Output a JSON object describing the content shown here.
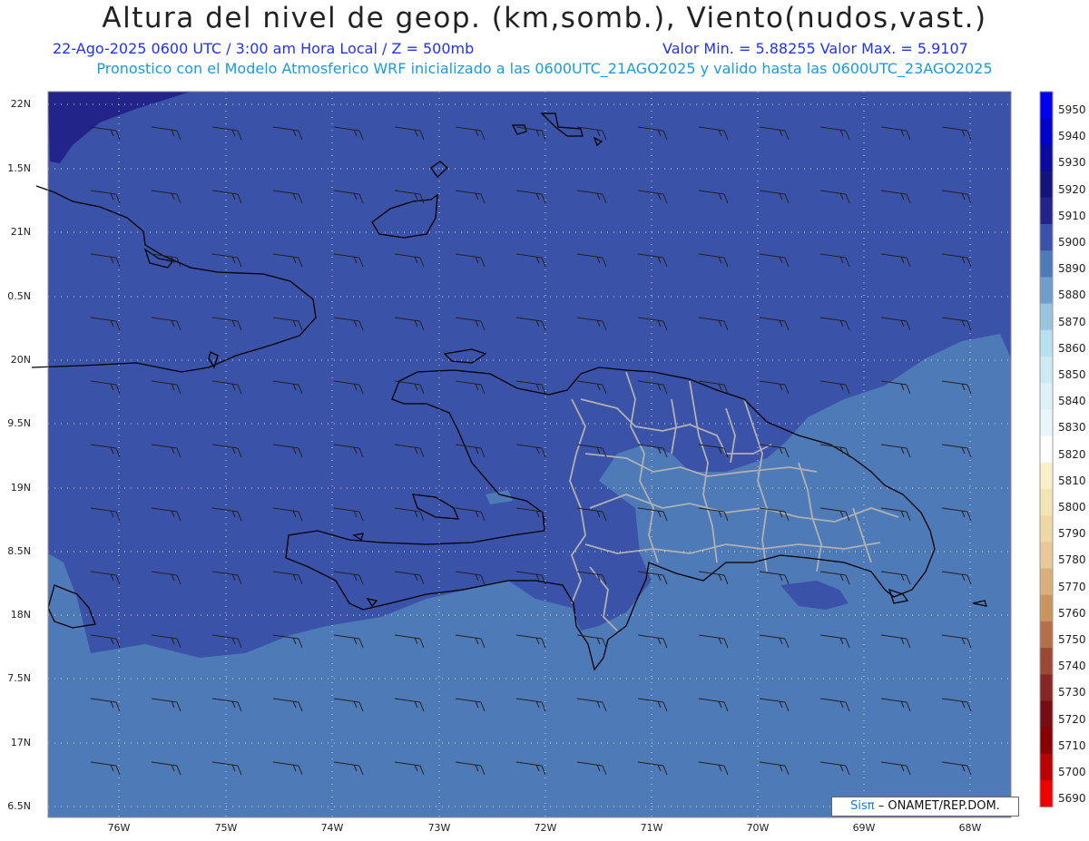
{
  "header": {
    "title": "Altura del nivel de geop. (km,somb.), Viento(nudos,vast.)",
    "line1_left": "22-Ago-2025  0600 UTC / 3:00 am Hora Local / Z = 500mb",
    "line1_right": "Valor Min. = 5.88255  Valor Max. = 5.9107",
    "line2": "Pronostico con el Modelo Atmosferico WRF inicializado a las 0600UTC_21AGO2025 y valido hasta las  0600UTC_23AGO2025"
  },
  "axes": {
    "lat_labels": [
      "22N",
      "1.5N",
      "21N",
      "0.5N",
      "20N",
      "9.5N",
      "19N",
      "8.5N",
      "18N",
      "7.5N",
      "17N",
      "6.5N"
    ],
    "lon_labels": [
      "76W",
      "75W",
      "74W",
      "73W",
      "72W",
      "71W",
      "70W",
      "69W",
      "68W"
    ]
  },
  "colorbar": {
    "levels": [
      "5950",
      "5940",
      "5930",
      "5920",
      "5910",
      "5900",
      "5890",
      "5880",
      "5870",
      "5860",
      "5850",
      "5840",
      "5830",
      "5820",
      "5810",
      "5800",
      "5790",
      "5780",
      "5770",
      "5760",
      "5750",
      "5740",
      "5730",
      "5720",
      "5710",
      "5700",
      "5690"
    ],
    "colors": [
      "#0000ee",
      "#0000cc",
      "#0a0aa0",
      "#14147e",
      "#22248a",
      "#3a52a8",
      "#4f7ab8",
      "#6f9dcc",
      "#98c4de",
      "#b9e0ee",
      "#cdeaf3",
      "#ddf1f7",
      "#e8f7fa",
      "#ffffff",
      "#f8f0c8",
      "#f2e4b4",
      "#eed8a6",
      "#e8c898",
      "#d9b07c",
      "#c99460",
      "#b47048",
      "#9a4a34",
      "#842626",
      "#760c14",
      "#880000",
      "#bb0000",
      "#ee0000"
    ]
  },
  "field": {
    "colors": {
      "z5910": "#22248a",
      "z5900": "#3a52a8",
      "z5890": "#4f7ab8"
    }
  },
  "map": {
    "colors": {
      "coast": "#000000",
      "provinces": "#b0b0b0",
      "grid": "#d8d8d8",
      "barb": "#222222"
    }
  },
  "credit": {
    "sis": "Sisπ",
    "rest": "– ONAMET/REP.DOM."
  }
}
